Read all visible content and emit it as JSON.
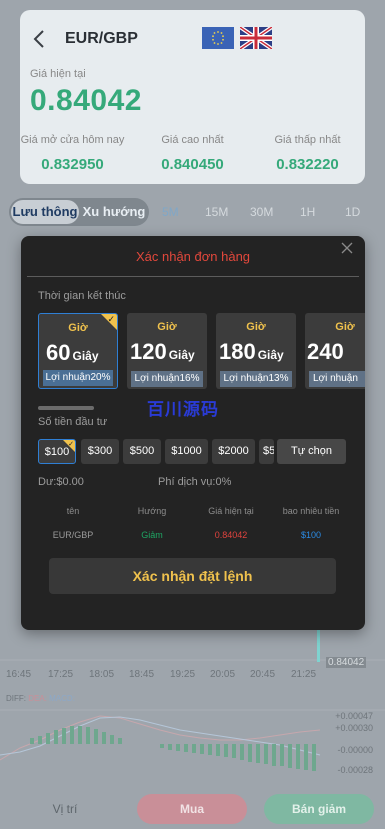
{
  "header": {
    "pair": "EUR/GBP",
    "flags": [
      "eu-flag",
      "uk-flag"
    ]
  },
  "price": {
    "current_label": "Giá hiện tại",
    "current": "0.84042",
    "open_label": "Giá mở cửa hôm nay",
    "open": "0.832950",
    "high_label": "Giá cao nhất",
    "high": "0.840450",
    "low_label": "Giá thấp nhất",
    "low": "0.832220"
  },
  "tabs": {
    "segment": [
      "Lưu thông",
      "Xu hướng"
    ],
    "timeframes": [
      "5M",
      "15M",
      "30M",
      "1H",
      "1D"
    ]
  },
  "chart": {
    "time_labels": [
      "16:45",
      "17:25",
      "18:05",
      "18:45",
      "19:25",
      "20:05",
      "20:45",
      "21:25"
    ],
    "price_tag": "0.84042",
    "macd_legend": [
      "DIFF:",
      "DEA:",
      "MACD:"
    ],
    "macd_values": [
      "+0.00047",
      "+0.00030",
      "-0.00000",
      "-0.00028"
    ]
  },
  "modal": {
    "title": "Xác nhận đơn hàng",
    "end_time_label": "Thời gian kết thúc",
    "time_options": [
      {
        "num": "60",
        "unit": "Giây",
        "label": "Giờ",
        "profit": "Lợi nhuận20%"
      },
      {
        "num": "120",
        "unit": "Giây",
        "label": "Giờ",
        "profit": "Lợi nhuận16%"
      },
      {
        "num": "180",
        "unit": "Giây",
        "label": "Giờ",
        "profit": "Lợi nhuận13%"
      },
      {
        "num": "240",
        "unit": "Giây",
        "label": "Giờ",
        "profit": "Lợi nhuận"
      }
    ],
    "watermark": "百川源码",
    "amount_label": "Số tiền đầu tư",
    "amounts": [
      "$100",
      "$300",
      "$500",
      "$1000",
      "$2000",
      "$5000"
    ],
    "custom_label": "Tự chọn",
    "balance": "Dư:$0.00",
    "fee": "Phí dịch vụ:0%",
    "summary_headers": [
      "tên",
      "Hướng",
      "Giá hiện tại",
      "bao nhiêu tiền"
    ],
    "summary_values": [
      "EUR/GBP",
      "Giảm",
      "0.84042",
      "$100"
    ],
    "confirm_label": "Xác nhận đặt lệnh"
  },
  "bottom": {
    "position_label": "Vị trí",
    "buy_label": "Mua",
    "sell_label": "Bán giảm"
  },
  "colors": {
    "price_green": "#35a97a",
    "modal_title_red": "#e2483c",
    "accent_gold": "#f0c24d",
    "select_blue": "#2f7fd4"
  }
}
